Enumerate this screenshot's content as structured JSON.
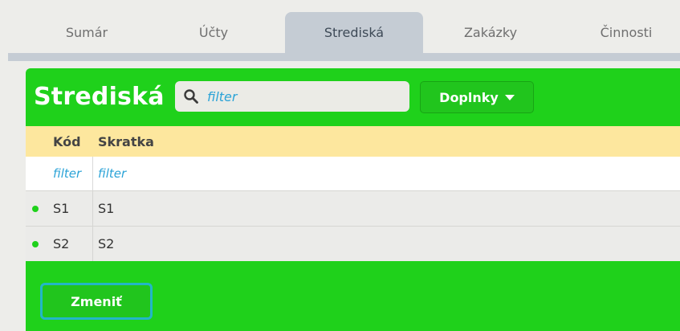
{
  "tabs": [
    {
      "label": "Sumár"
    },
    {
      "label": "Účty"
    },
    {
      "label": "Strediská",
      "active": true
    },
    {
      "label": "Zakázky"
    },
    {
      "label": "Činnosti"
    }
  ],
  "panel": {
    "title": "Strediská",
    "search_placeholder": "filter",
    "addons_label": "Doplnky",
    "change_label": "Zmeniť"
  },
  "table": {
    "columns": [
      "Kód",
      "Skratka"
    ],
    "filters": [
      "filter",
      "filter"
    ],
    "rows": [
      {
        "kod": "S1",
        "skratka": "S1"
      },
      {
        "kod": "S2",
        "skratka": "S2"
      }
    ]
  },
  "colors": {
    "panel_green": "#1fd11b",
    "header_yellow": "#fde79e",
    "filter_blue": "#2ba3d7",
    "active_tab": "#c5ccd4"
  }
}
